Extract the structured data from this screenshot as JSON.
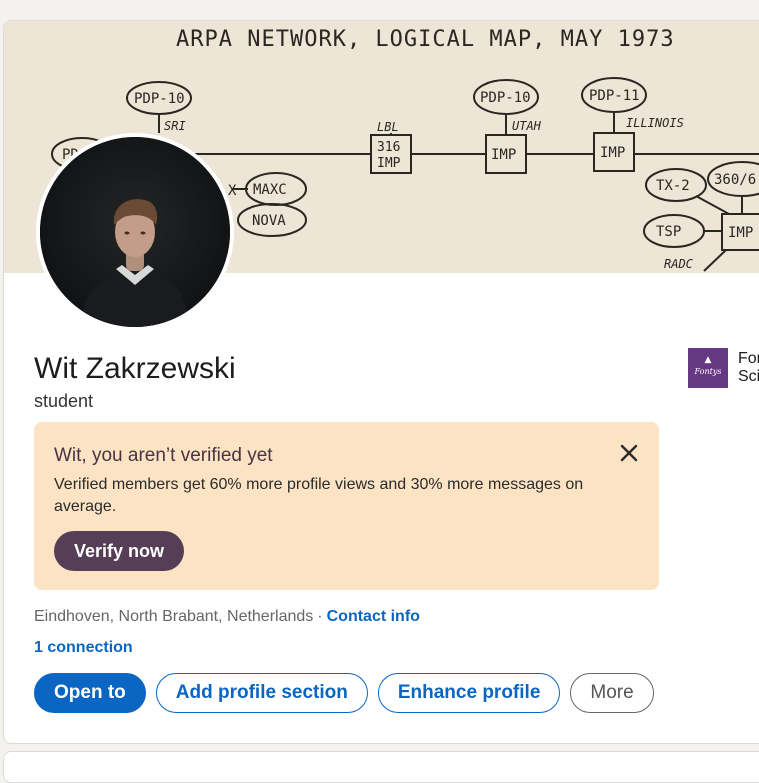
{
  "banner": {
    "title": "ARPA NETWORK, LOGICAL MAP, MAY 1973",
    "nodes": {
      "pdp10_sri": "PDP-10",
      "sri": "SRI",
      "pdp_left": "PD",
      "lbl": "LBL",
      "imp_lbl": "316\nIMP",
      "pdp10_utah": "PDP-10",
      "utah": "UTAH",
      "imp_utah": "IMP",
      "pdp11": "PDP-11",
      "illinois": "ILLINOIS",
      "imp_illinois": "IMP",
      "x": "X",
      "maxc": "MAXC",
      "nova": "NOVA",
      "tx2": "TX-2",
      "ibm360": "360/6",
      "tsp": "TSP",
      "imp_right": "IMP",
      "radc": "RADC"
    }
  },
  "profile": {
    "name": "Wit Zakrzewski",
    "headline": "student"
  },
  "education": {
    "logo_text": "Fontys",
    "name_line1": "Fon",
    "name_line2": "Sci"
  },
  "verify": {
    "title": "Wit, you aren’t verified yet",
    "text": "Verified members get 60% more profile views and 30% more messages on average.",
    "button": "Verify now"
  },
  "location": {
    "text": "Eindhoven, North Brabant, Netherlands",
    "separator": "·",
    "contact_link": "Contact info"
  },
  "connections": "1 connection",
  "actions": {
    "open_to": "Open to",
    "add_section": "Add profile section",
    "enhance": "Enhance profile",
    "more": "More"
  },
  "icons": {
    "close": "close-icon"
  },
  "colors": {
    "accent": "#0a66c2",
    "verify_bg": "#fbe3c3",
    "verify_button": "#563e56",
    "school_logo": "#663782"
  }
}
